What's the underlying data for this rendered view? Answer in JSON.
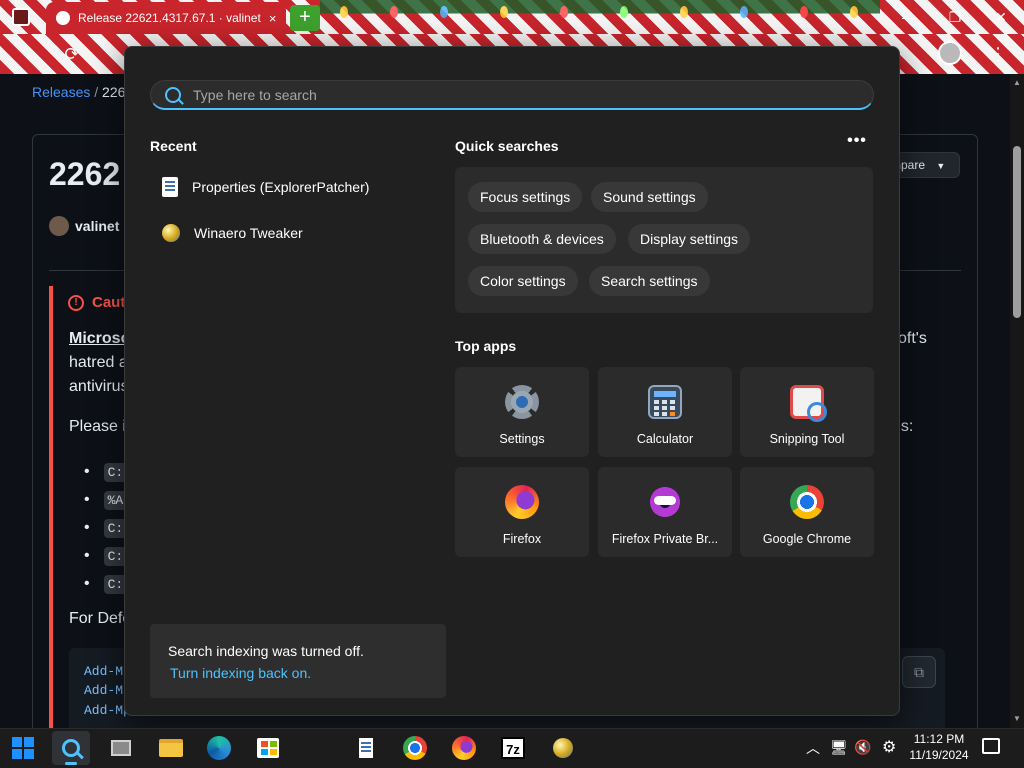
{
  "browser": {
    "tab_title": "Release 22621.4317.67.1 · valinet",
    "tab_close": "×",
    "new_tab": "+",
    "win_minimize": "—",
    "win_maximize": "❐",
    "win_close": "✕"
  },
  "page": {
    "breadcrumb_releases": "Releases",
    "breadcrumb_sep": "/",
    "breadcrumb_current": "2262",
    "release_title": "2262",
    "author": "valinet r",
    "compare_label": "mpare",
    "caution_title": "Cauti",
    "para1_line1": "Microsc",
    "para1_line1_tail": "oft's",
    "para1_line2": "hatred a",
    "para1_line3": "antivirus",
    "para2_line": "Please in",
    "para2_tail": "ns:",
    "bullets": [
      "C:\\",
      "%AI",
      "C:\\",
      "C:\\",
      "C:\\"
    ],
    "para3_line": "For Defe",
    "code_lines": [
      "Add-Mp",
      "Add-Mp",
      "Add-Mp"
    ]
  },
  "search": {
    "placeholder": "Type here to search",
    "recent_title": "Recent",
    "recent_items": [
      {
        "label": "Properties (ExplorerPatcher)",
        "icon": "document-icon"
      },
      {
        "label": "Winaero Tweaker",
        "icon": "winaero-icon"
      }
    ],
    "quick_title": "Quick searches",
    "more_label": "•••",
    "quick_searches": [
      "Focus settings",
      "Sound settings",
      "Bluetooth & devices",
      "Display settings",
      "Color settings",
      "Search settings"
    ],
    "top_apps_title": "Top apps",
    "top_apps": [
      {
        "label": "Settings",
        "icon": "settings-icon"
      },
      {
        "label": "Calculator",
        "icon": "calculator-icon"
      },
      {
        "label": "Snipping Tool",
        "icon": "snipping-tool-icon"
      },
      {
        "label": "Firefox",
        "icon": "firefox-icon"
      },
      {
        "label": "Firefox Private Br...",
        "icon": "firefox-private-icon"
      },
      {
        "label": "Google Chrome",
        "icon": "chrome-icon"
      }
    ],
    "notice_text": "Search indexing was turned off.",
    "notice_link": "Turn indexing back on."
  },
  "taskbar": {
    "time": "11:12 PM",
    "date": "11/19/2024",
    "sevenzip_label": "7z",
    "tray_chevron": "︿"
  },
  "colors": {
    "accent": "#4cc2ff",
    "flyout_bg": "#202020",
    "tile_bg": "#2b2b2b",
    "caution": "#f85149",
    "link": "#4493f8"
  }
}
